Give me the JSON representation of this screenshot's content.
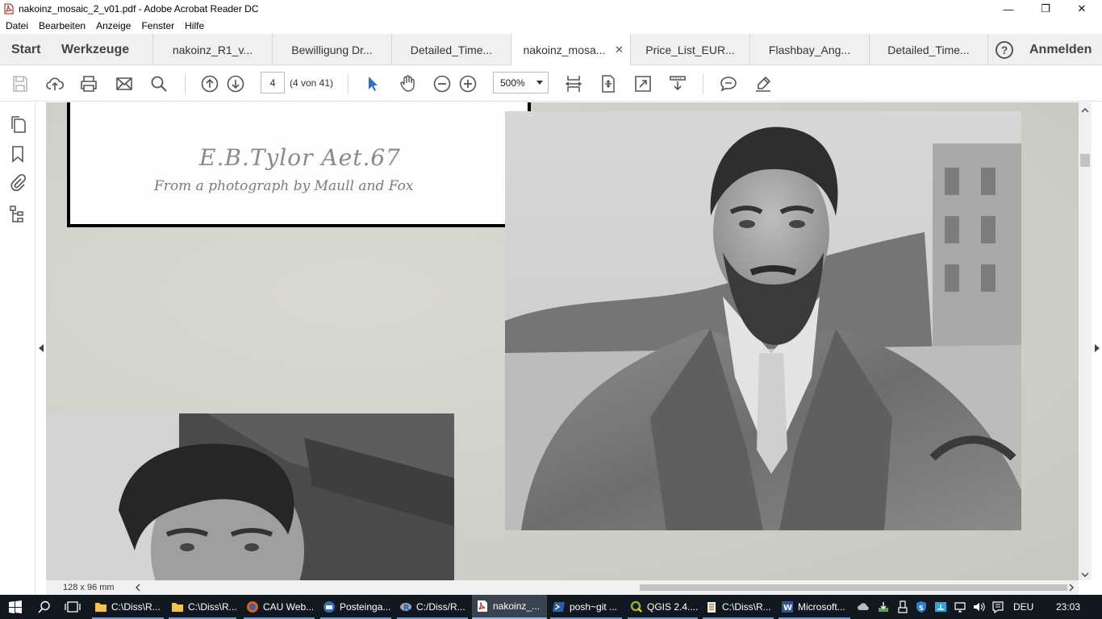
{
  "window": {
    "title": "nakoinz_mosaic_2_v01.pdf - Adobe Acrobat Reader DC",
    "minimize": "—",
    "maximize": "❐",
    "close": "✕"
  },
  "menu": [
    "Datei",
    "Bearbeiten",
    "Anzeige",
    "Fenster",
    "Hilfe"
  ],
  "tabs": {
    "start": "Start",
    "tools": "Werkzeuge",
    "documents": [
      "nakoinz_R1_v...",
      "Bewilligung Dr...",
      "Detailed_Time...",
      "nakoinz_mosa...",
      "Price_List_EUR...",
      "Flashbay_Ang...",
      "Detailed_Time..."
    ],
    "active_index": 3,
    "close_symbol": "✕",
    "help": "?",
    "sign_in": "Anmelden"
  },
  "toolbar": {
    "page_number": "4",
    "page_count": "(4 von 41)",
    "zoom": "500%",
    "icons": [
      "save-icon",
      "cloud-upload-icon",
      "print-icon",
      "email-icon",
      "search-icon",
      "page-up-icon",
      "page-down-icon",
      "select-cursor-icon",
      "hand-tool-icon",
      "zoom-out-icon",
      "zoom-in-icon",
      "fit-width-icon",
      "fit-page-icon",
      "full-screen-icon",
      "read-mode-icon",
      "comment-icon",
      "highlight-pen-icon"
    ]
  },
  "left_rail": {
    "icons": [
      "page-thumbnails-icon",
      "bookmarks-icon",
      "attachments-icon",
      "content-tree-icon"
    ]
  },
  "document": {
    "caption_line1": "E.B.Tylor  Aet.67",
    "caption_line2": "From a photograph by Maull and Fox",
    "page_size": "128 x 96 mm"
  },
  "taskbar": {
    "items": [
      {
        "label": "C:\\Diss\\R...",
        "icon": "folder-icon"
      },
      {
        "label": "C:\\Diss\\R...",
        "icon": "folder-icon"
      },
      {
        "label": "CAU Web...",
        "icon": "firefox-icon"
      },
      {
        "label": "Posteinga...",
        "icon": "mail-client-icon"
      },
      {
        "label": "C:/Diss/R...",
        "icon": "r-icon"
      },
      {
        "label": "nakoinz_...",
        "icon": "acrobat-icon"
      },
      {
        "label": "posh~git ...",
        "icon": "powershell-icon"
      },
      {
        "label": "QGIS 2.4....",
        "icon": "qgis-icon"
      },
      {
        "label": "C:\\Diss\\R...",
        "icon": "notepad-icon"
      },
      {
        "label": "Microsoft...",
        "icon": "word-icon"
      }
    ],
    "language": "DEU",
    "time": "23:03"
  },
  "colors": {
    "taskbar": "#121820",
    "select_tool": "#2a6fd6",
    "doc_background": "#cfd0c8"
  }
}
